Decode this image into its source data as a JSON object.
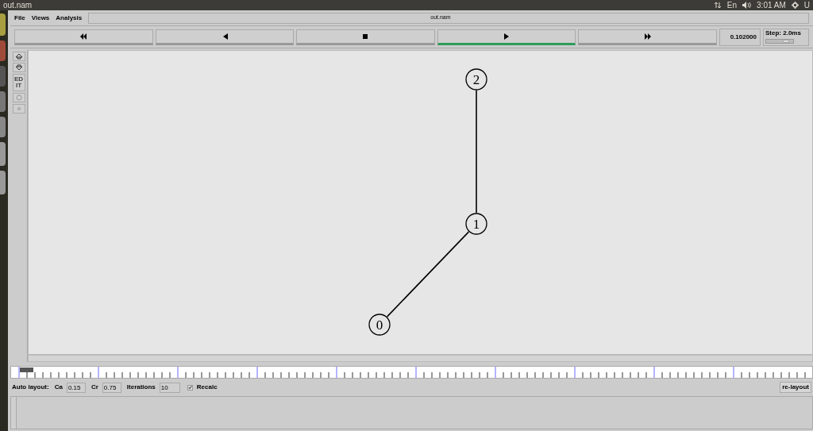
{
  "top_bar": {
    "title": "out.nam",
    "tray": [
      {
        "kind": "arrows"
      },
      {
        "kind": "text",
        "text": "En"
      },
      {
        "kind": "volume"
      },
      {
        "kind": "text",
        "text": "3:01 AM"
      },
      {
        "kind": "gear"
      },
      {
        "kind": "text",
        "text": "U"
      }
    ]
  },
  "menu": [
    "File",
    "Views",
    "Analysis"
  ],
  "window_title": "out.nam",
  "playback": [
    {
      "kind": "rewind",
      "selected": false
    },
    {
      "kind": "back",
      "selected": false
    },
    {
      "kind": "stop",
      "selected": false
    },
    {
      "kind": "play",
      "selected": true
    },
    {
      "kind": "forward",
      "selected": false
    }
  ],
  "time": "0.102000",
  "step": {
    "label": "Step: 2.0ms",
    "level": 0.8
  },
  "tools": [
    {
      "kind": "zoom-in"
    },
    {
      "kind": "zoom-out"
    },
    {
      "kind": "edit",
      "text": "ED\nIT"
    },
    {
      "kind": "circle"
    },
    {
      "kind": "dot"
    }
  ],
  "nodes": [
    {
      "label": "0",
      "linked_to_previous": false
    },
    {
      "label": "1",
      "linked_to_previous": true
    },
    {
      "label": "2",
      "linked_to_previous": true
    }
  ],
  "auto_layout": {
    "label": "Auto layout:",
    "fields": [
      {
        "label": "Ca",
        "value": "0.15"
      },
      {
        "label": "Cr",
        "value": "0.75"
      },
      {
        "label": "Iterations",
        "value": "10"
      }
    ],
    "recalc": {
      "label": "Recalc",
      "checked": true
    },
    "button": "re-layout"
  }
}
